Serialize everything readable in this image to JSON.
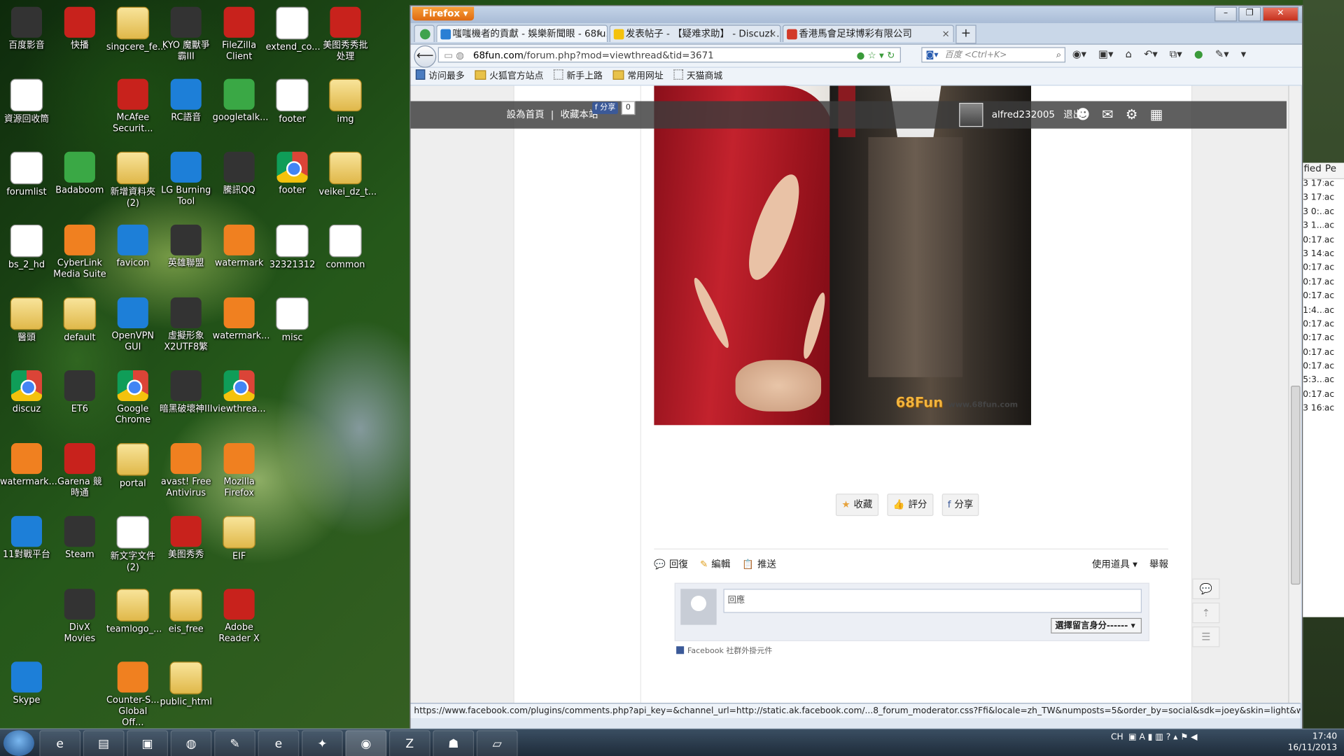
{
  "desktop": {
    "icons": [
      {
        "label": "百度影音",
        "kind": "dark"
      },
      {
        "label": "快播",
        "kind": "red"
      },
      {
        "label": "singcere_fe...",
        "kind": "fold"
      },
      {
        "label": "KYO 魔獸爭霸III",
        "kind": "dark"
      },
      {
        "label": "FileZilla Client",
        "kind": "red"
      },
      {
        "label": "extend_co...",
        "kind": "doc"
      },
      {
        "label": "美图秀秀批处理",
        "kind": "red"
      },
      {
        "label": "資源回收筒",
        "kind": "doc"
      },
      {
        "label": "McAfee Securit...",
        "kind": "red"
      },
      {
        "label": "RC語音",
        "kind": "blue"
      },
      {
        "label": "googletalk...",
        "kind": "green"
      },
      {
        "label": "footer",
        "kind": "doc"
      },
      {
        "label": "img",
        "kind": "fold"
      },
      {
        "label": "forumlist",
        "kind": "doc"
      },
      {
        "label": "Badaboom",
        "kind": "green"
      },
      {
        "label": "新增資料夾 (2)",
        "kind": "fold"
      },
      {
        "label": "LG Burning Tool",
        "kind": "blue"
      },
      {
        "label": "騰訊QQ",
        "kind": "dark"
      },
      {
        "label": "footer",
        "kind": "chrome"
      },
      {
        "label": "veikei_dz_t...",
        "kind": "fold"
      },
      {
        "label": "bs_2_hd",
        "kind": "doc"
      },
      {
        "label": "CyberLink Media Suite",
        "kind": "orange"
      },
      {
        "label": "favicon",
        "kind": "blue"
      },
      {
        "label": "英雄聯盟",
        "kind": "dark"
      },
      {
        "label": "watermark",
        "kind": "orange"
      },
      {
        "label": "32321312",
        "kind": "doc"
      },
      {
        "label": "common",
        "kind": "doc"
      },
      {
        "label": "醫頭",
        "kind": "fold"
      },
      {
        "label": "default",
        "kind": "fold"
      },
      {
        "label": "OpenVPN GUI",
        "kind": "blue"
      },
      {
        "label": "虛擬形象X2UTF8繁",
        "kind": "dark"
      },
      {
        "label": "watermark...",
        "kind": "orange"
      },
      {
        "label": "misc",
        "kind": "doc"
      },
      {
        "label": "discuz",
        "kind": "chrome"
      },
      {
        "label": "ET6",
        "kind": "dark"
      },
      {
        "label": "Google Chrome",
        "kind": "chrome"
      },
      {
        "label": "暗黑破壞神III",
        "kind": "dark"
      },
      {
        "label": "viewthrea...",
        "kind": "chrome"
      },
      {
        "label": "watermark...",
        "kind": "orange"
      },
      {
        "label": "Garena 競時通",
        "kind": "red"
      },
      {
        "label": "portal",
        "kind": "fold"
      },
      {
        "label": "avast! Free Antivirus",
        "kind": "orange"
      },
      {
        "label": "Mozilla Firefox",
        "kind": "orange"
      },
      {
        "label": "11對戰平台",
        "kind": "blue"
      },
      {
        "label": "Steam",
        "kind": "dark"
      },
      {
        "label": "新文字文件 (2)",
        "kind": "doc"
      },
      {
        "label": "美图秀秀",
        "kind": "red"
      },
      {
        "label": "EIF",
        "kind": "fold"
      },
      {
        "label": "DivX Movies",
        "kind": "dark"
      },
      {
        "label": "teamlogo_...",
        "kind": "fold"
      },
      {
        "label": "eis_free",
        "kind": "fold"
      },
      {
        "label": "Adobe Reader X",
        "kind": "red"
      },
      {
        "label": "Skype",
        "kind": "blue"
      },
      {
        "label": "Counter-S... Global Off...",
        "kind": "orange"
      },
      {
        "label": "public_html",
        "kind": "fold"
      }
    ]
  },
  "side_panel": {
    "headers": [
      "fied",
      "Pe"
    ],
    "rows": [
      [
        "3 17:...",
        "ac"
      ],
      [
        "3 17:...",
        "ac"
      ],
      [
        "3 0:...",
        "ac"
      ],
      [
        "3 1...",
        "ac"
      ],
      [
        "0:17...",
        "ac"
      ],
      [
        "3 14:...",
        "ac"
      ],
      [
        "0:17...",
        "ac"
      ],
      [
        "0:17...",
        "ac"
      ],
      [
        "0:17...",
        "ac"
      ],
      [
        "1:4...",
        "ac"
      ],
      [
        "0:17...",
        "ac"
      ],
      [
        "0:17...",
        "ac"
      ],
      [
        "0:17...",
        "ac"
      ],
      [
        "0:17...",
        "ac"
      ],
      [
        "5:3...",
        "ac"
      ],
      [
        "0:17...",
        "ac"
      ],
      [
        "3 16:...",
        "ac"
      ]
    ]
  },
  "browser": {
    "app_button": "Firefox",
    "tabs": [
      {
        "title": "嗤嗤機者的貢獻 - 娛樂新聞眼 - 68fu...",
        "active": true,
        "color": "#2a7fd4"
      },
      {
        "title": "发表帖子 - 【疑难求助】 - Discuz! ...",
        "active": false,
        "color": "#f4c20d"
      },
      {
        "title": "香港馬會足球博彩有限公司",
        "active": false,
        "color": "#d23a2a"
      }
    ],
    "url_host": "68fun.com",
    "url_path": "/forum.php?mod=viewthread&tid=3671",
    "search_placeholder": "百度 <Ctrl+K>",
    "bookmarks": [
      {
        "label": "访问最多",
        "kind": "icon"
      },
      {
        "label": "火狐官方站点",
        "kind": "fold"
      },
      {
        "label": "新手上路",
        "kind": "blank"
      },
      {
        "label": "常用网址",
        "kind": "fold"
      },
      {
        "label": "天猫商城",
        "kind": "blank"
      }
    ],
    "status_text": "https://www.facebook.com/plugins/comments.php?api_key=&channel_url=http://static.ak.facebook.com/...8_forum_moderator.css?Ffi&locale=zh_TW&numposts=5&order_by=social&sdk=joey&skin=light&width=680#"
  },
  "page": {
    "topbar": {
      "set_home": "設為首頁",
      "separator": "|",
      "bookmark_site": "收藏本站",
      "fb_share": "f 分享",
      "fb_count": "0",
      "username": "alfred232005",
      "logout": "退出"
    },
    "watermark": "68Fun",
    "watermark_url": "www.68fun.com",
    "actions": [
      {
        "label": "收藏",
        "icon": "★"
      },
      {
        "label": "評分",
        "icon": "👍"
      },
      {
        "label": "分享",
        "icon": "f"
      }
    ],
    "post_tools_left": [
      {
        "label": "回復",
        "icon": "💬"
      },
      {
        "label": "編輯",
        "icon": "✎"
      },
      {
        "label": "推送",
        "icon": "📋"
      }
    ],
    "post_tools_right": [
      "使用道具 ▾",
      "舉報"
    ],
    "fb_comment_placeholder": "回應",
    "fb_identity_select": "選擇留言身分------ ▾",
    "fb_footer": "Facebook 社群外掛元件"
  },
  "taskbar": {
    "items": [
      "IE",
      "Explorer",
      "Monitor",
      "Chrome",
      "Paint",
      "IE9",
      "Tool",
      "Firefox",
      "FileZilla",
      "Garena",
      "Files"
    ],
    "active_index": 7,
    "lang": "CH",
    "time": "17:40",
    "date": "16/11/2013"
  }
}
